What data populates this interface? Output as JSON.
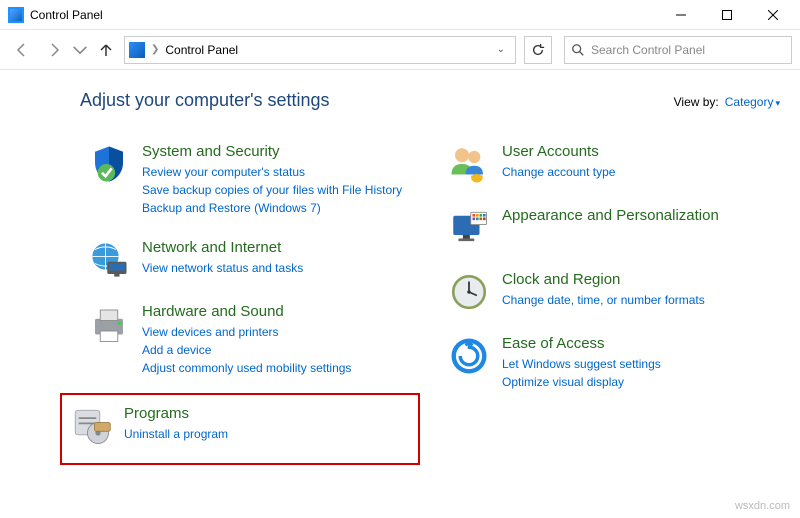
{
  "window": {
    "title": "Control Panel"
  },
  "breadcrumb": {
    "label": "Control Panel"
  },
  "search": {
    "placeholder": "Search Control Panel"
  },
  "header": {
    "heading": "Adjust your computer's settings",
    "view_by_label": "View by:",
    "view_by_value": "Category"
  },
  "categories": {
    "system_security": {
      "title": "System and Security",
      "links": [
        "Review your computer's status",
        "Save backup copies of your files with File History",
        "Backup and Restore (Windows 7)"
      ]
    },
    "network": {
      "title": "Network and Internet",
      "links": [
        "View network status and tasks"
      ]
    },
    "hardware": {
      "title": "Hardware and Sound",
      "links": [
        "View devices and printers",
        "Add a device",
        "Adjust commonly used mobility settings"
      ]
    },
    "programs": {
      "title": "Programs",
      "links": [
        "Uninstall a program"
      ]
    },
    "user_accounts": {
      "title": "User Accounts",
      "links": [
        "Change account type"
      ]
    },
    "appearance": {
      "title": "Appearance and Personalization",
      "links": []
    },
    "clock": {
      "title": "Clock and Region",
      "links": [
        "Change date, time, or number formats"
      ]
    },
    "ease": {
      "title": "Ease of Access",
      "links": [
        "Let Windows suggest settings",
        "Optimize visual display"
      ]
    }
  },
  "watermark": "wsxdn.com"
}
